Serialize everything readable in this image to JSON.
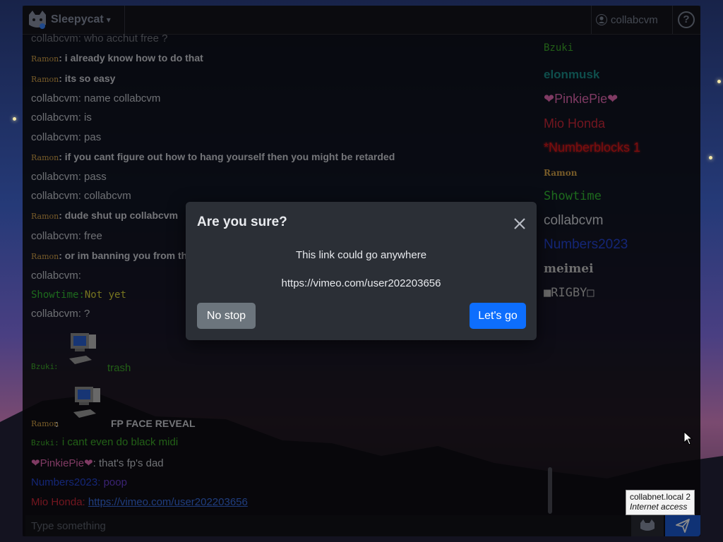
{
  "brand": {
    "name": "Sleepycat",
    "caret": "▾"
  },
  "topbar": {
    "user_name": "collabcvm",
    "help_glyph": "?"
  },
  "messages": [
    {
      "nick": "collabcvm",
      "text": "who acchut free ?"
    },
    {
      "nick": "Ramon",
      "text": "i already know how to do that"
    },
    {
      "nick": "Ramon",
      "text": "its so easy"
    },
    {
      "nick": "collabcvm",
      "text": "name collabcvm"
    },
    {
      "nick": "collabcvm",
      "text": "is"
    },
    {
      "nick": "collabcvm",
      "text": "pas"
    },
    {
      "nick": "Ramon",
      "text": "if you cant figure out how to hang yourself then you might be retarded"
    },
    {
      "nick": "collabcvm",
      "text": "pass"
    },
    {
      "nick": "collabcvm",
      "text": "collabcvm"
    },
    {
      "nick": "Ramon",
      "text": "dude shut up collabcvm"
    },
    {
      "nick": "collabcvm",
      "text": "free"
    },
    {
      "nick": "Ramon",
      "text": "or im banning you from thi"
    },
    {
      "nick": "collabcvm",
      "text": ""
    },
    {
      "nick": "Showtime",
      "text": "Not yet"
    },
    {
      "nick": "collabcvm",
      "text": "?"
    },
    {
      "nick": "Bzuki",
      "text": "trash"
    },
    {
      "nick": "Ramon",
      "text": "FP FACE REVEAL"
    },
    {
      "nick": "Bzuki",
      "text": "i cant even do black midi"
    },
    {
      "nick": "❤PinkiePie❤",
      "text": "that's fp's dad"
    },
    {
      "nick": "Numbers2023",
      "text": "poop"
    },
    {
      "nick": "Mio Honda",
      "text": "https://vimeo.com/user202203656"
    }
  ],
  "users": [
    {
      "name": "Bzuki",
      "color": "#3fae2a"
    },
    {
      "name": "elonmusk",
      "color": "#1b8f8a"
    },
    {
      "name": "❤PinkiePie❤",
      "color": "#e86ab4"
    },
    {
      "name": "Mio Honda",
      "color": "#d0283a"
    },
    {
      "name": "*Numberblocks 1",
      "color": "#e01818"
    },
    {
      "name": "Ramon",
      "color": "#d9a64a"
    },
    {
      "name": "Showtime",
      "color": "#35c235"
    },
    {
      "name": "collabcvm",
      "color": "#d8dae0"
    },
    {
      "name": "Numbers2023",
      "color": "#2646d8"
    },
    {
      "name": "meimei",
      "color": "#c8c8c8"
    },
    {
      "name": "■RIGBY□",
      "color": "#bfbfbf"
    }
  ],
  "input": {
    "placeholder": "Type something"
  },
  "modal": {
    "title": "Are you sure?",
    "message": "This link could go anywhere",
    "url": "https://vimeo.com/user202203656",
    "cancel_label": "No stop",
    "confirm_label": "Let's go"
  },
  "tooltip": {
    "host": "collabnet.local",
    "count": "2",
    "status": "Internet access"
  },
  "colors": {
    "accent": "#0d6efd",
    "send": "#1d5bd6",
    "cancel": "#6c757d",
    "ramon": "#d9a64a",
    "bzuki": "#3fae2a",
    "link": "#3a6fe6"
  }
}
